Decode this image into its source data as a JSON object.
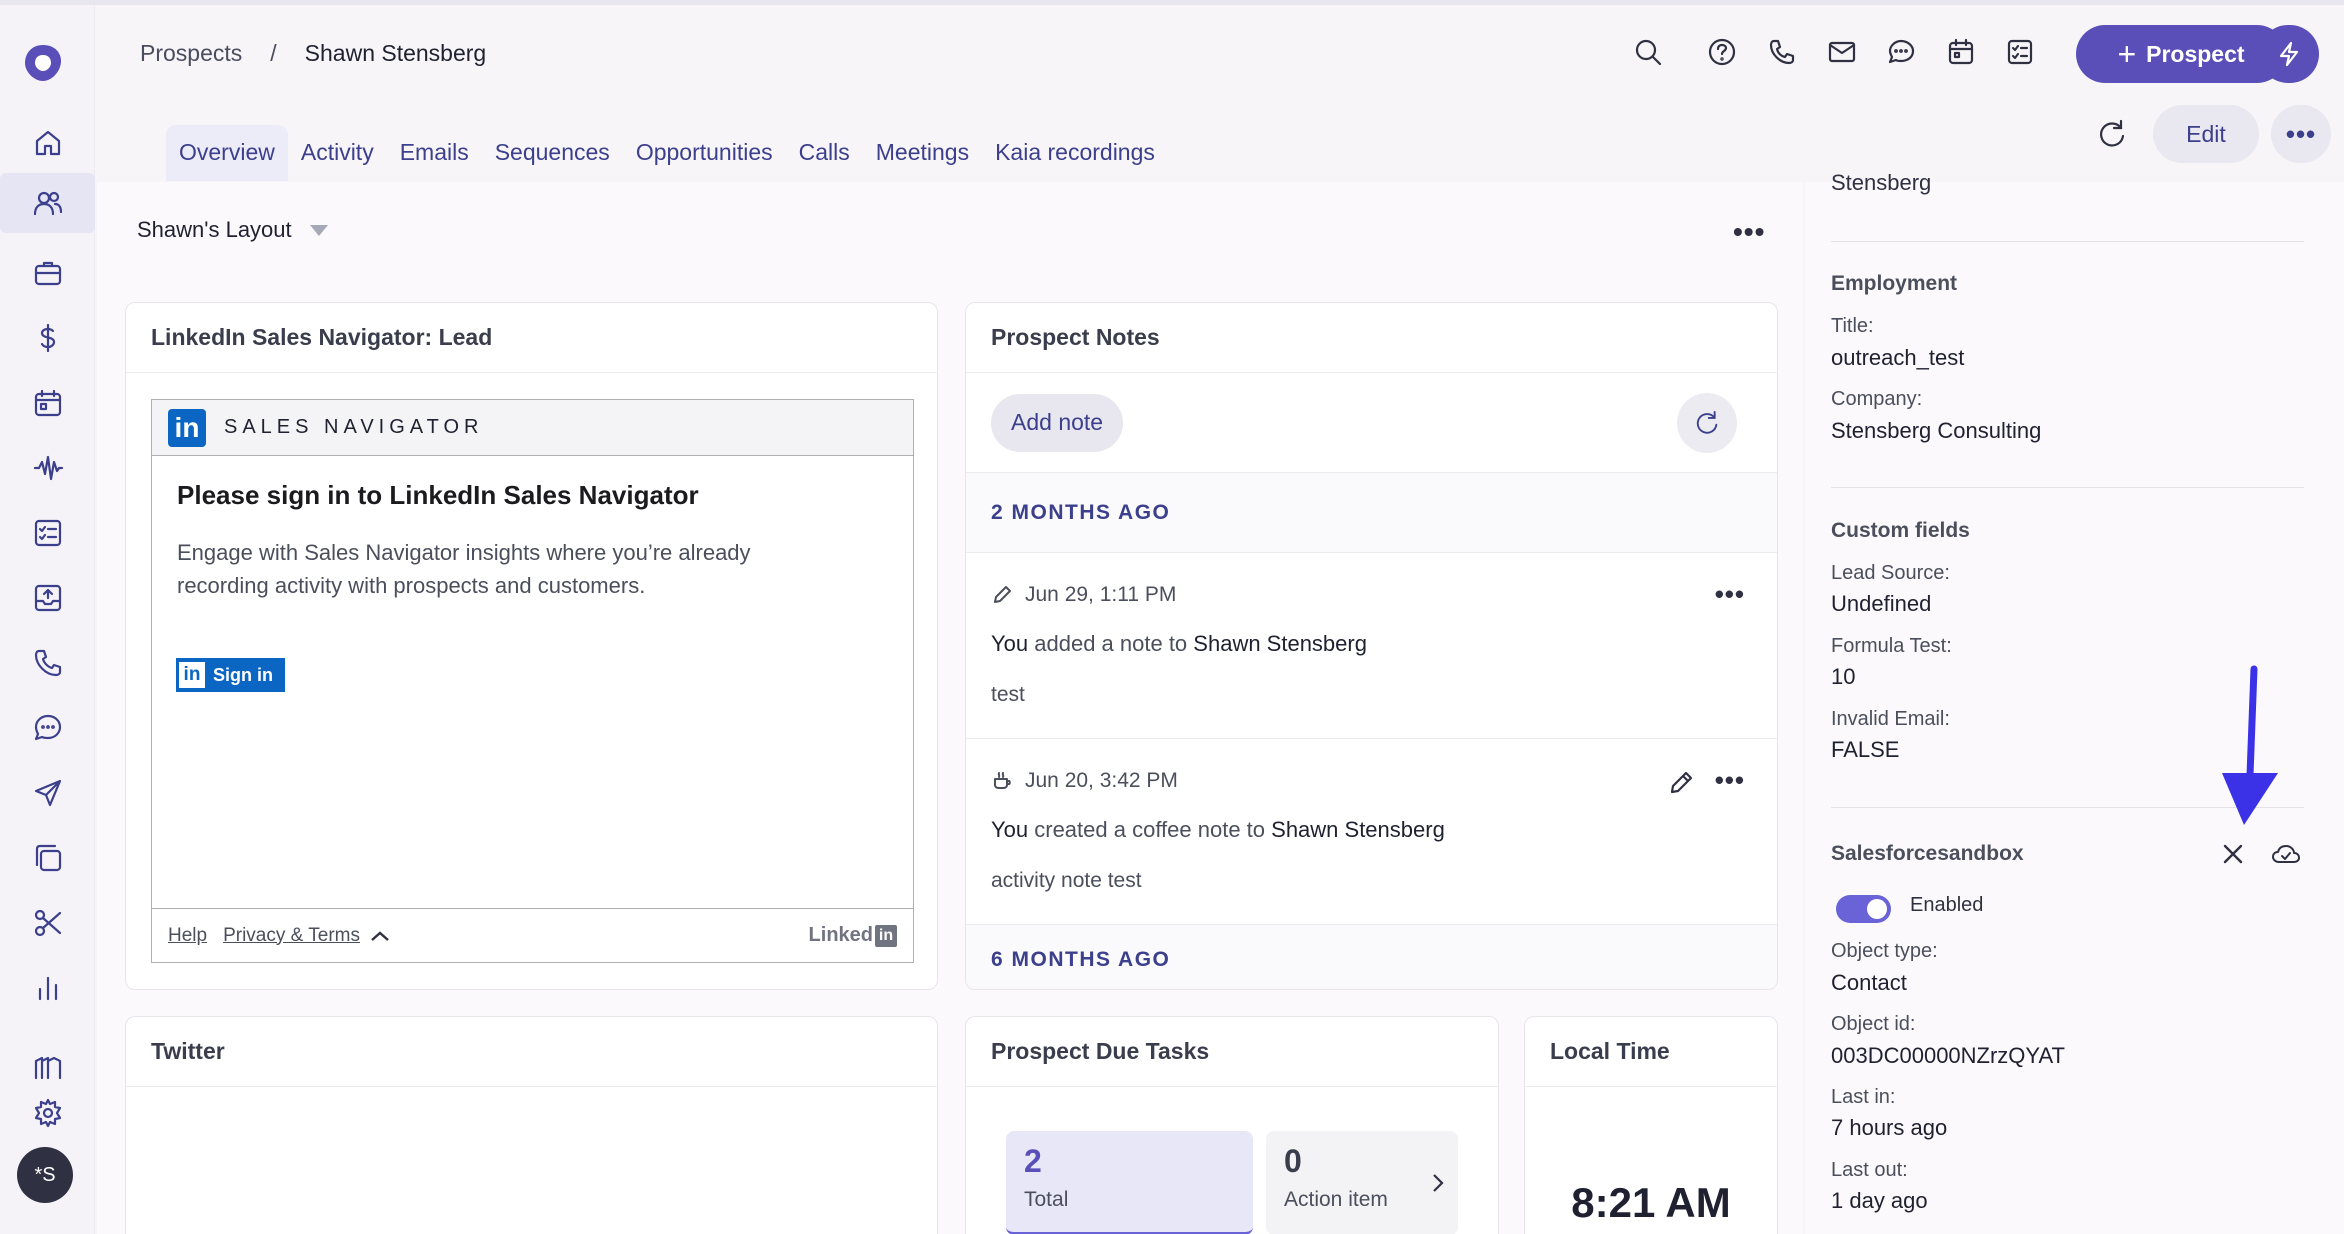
{
  "breadcrumb": {
    "parent": "Prospects",
    "separator": "/",
    "current": "Shawn Stensberg"
  },
  "header": {
    "prospect_button": "Prospect",
    "edit_button": "Edit"
  },
  "tabs": [
    "Overview",
    "Activity",
    "Emails",
    "Sequences",
    "Opportunities",
    "Calls",
    "Meetings",
    "Kaia recordings"
  ],
  "layout": {
    "name": "Shawn's Layout"
  },
  "linkedin": {
    "card_title": "LinkedIn Sales Navigator: Lead",
    "brand": "SALES NAVIGATOR",
    "logo_text": "in",
    "heading": "Please sign in to LinkedIn Sales Navigator",
    "body": "Engage with Sales Navigator insights where you’re already recording activity with prospects and customers.",
    "signin": "Sign in",
    "footer_help": "Help",
    "footer_privacy": "Privacy & Terms",
    "footer_brand": "Linked",
    "footer_brand_in": "in"
  },
  "notes": {
    "card_title": "Prospect Notes",
    "add_note": "Add note",
    "section1": "2 MONTHS AGO",
    "section2": "6 MONTHS AGO",
    "items": [
      {
        "date": "Jun 29, 1:11 PM",
        "you": "You",
        "action": "added a note to",
        "person": "Shawn Stensberg",
        "body": "test"
      },
      {
        "date": "Jun 20, 3:42 PM",
        "you": "You",
        "action": "created a coffee note to",
        "person": "Shawn Stensberg",
        "body": "activity note test"
      }
    ]
  },
  "twitter": {
    "card_title": "Twitter"
  },
  "tasks": {
    "card_title": "Prospect Due Tasks",
    "total_count": "2",
    "total_label": "Total",
    "action_count": "0",
    "action_label": "Action item"
  },
  "local_time": {
    "card_title": "Local Time",
    "time": "8:21 AM"
  },
  "right_panel": {
    "name_fragment": "Stensberg",
    "employment_heading": "Employment",
    "title_label": "Title:",
    "title_value": "outreach_test",
    "company_label": "Company:",
    "company_value": "Stensberg Consulting",
    "custom_heading": "Custom fields",
    "lead_source_label": "Lead Source:",
    "lead_source_value": "Undefined",
    "formula_label": "Formula Test:",
    "formula_value": "10",
    "invalid_email_label": "Invalid Email:",
    "invalid_email_value": "FALSE",
    "sandbox_heading": "Salesforcesandbox",
    "enabled_label": "Enabled",
    "object_type_label": "Object type:",
    "object_type_value": "Contact",
    "object_id_label": "Object id:",
    "object_id_value": "003DC00000NZrzQYAT",
    "last_in_label": "Last in:",
    "last_in_value": "7 hours ago",
    "last_out_label": "Last out:",
    "last_out_value": "1 day ago"
  },
  "user": {
    "initials": "*S"
  },
  "colors": {
    "accent": "#5a4fb8",
    "nav": "#3b3f8c",
    "annotation_arrow": "#3b32e8",
    "linkedin": "#0a66c2"
  }
}
